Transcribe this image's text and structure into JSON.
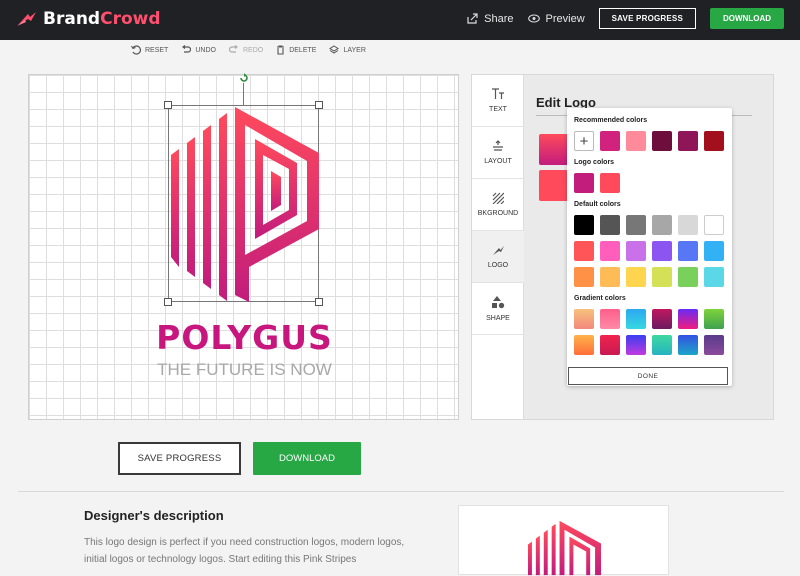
{
  "brand": {
    "name_part1": "Brand",
    "name_part2": "Crowd"
  },
  "topbar": {
    "share_label": "Share",
    "preview_label": "Preview",
    "save_label": "SAVE PROGRESS",
    "download_label": "DOWNLOAD"
  },
  "toolbar": {
    "reset": "RESET",
    "undo": "UNDO",
    "redo": "REDO",
    "delete": "DELETE",
    "layer": "LAYER"
  },
  "logo": {
    "name": "POLYGUS",
    "tagline": "THE FUTURE IS NOW"
  },
  "panel": {
    "title": "Edit Logo",
    "tabs": [
      {
        "label": "TEXT",
        "icon": "text-icon"
      },
      {
        "label": "LAYOUT",
        "icon": "layout-icon"
      },
      {
        "label": "BKGROUND",
        "icon": "background-icon"
      },
      {
        "label": "LOGO",
        "icon": "logo-icon"
      },
      {
        "label": "SHAPE",
        "icon": "shape-icon"
      }
    ]
  },
  "color_picker": {
    "recommended_label": "Recommended colors",
    "recommended": [
      "#d1227d",
      "#ff8a99",
      "#6e0e3d",
      "#8e1558",
      "#a1101c"
    ],
    "logo_label": "Logo colors",
    "logo": [
      "#c21c7d",
      "#ff4a5c"
    ],
    "default_label": "Default colors",
    "default": [
      [
        "#000000",
        "#555555",
        "#777777",
        "#a7a7a7",
        "#d8d8d8",
        "#ffffff"
      ],
      [
        "#ff5559",
        "#ff5ebd",
        "#c871e8",
        "#8c55f2",
        "#5877f4",
        "#33b1f5"
      ],
      [
        "#ff9146",
        "#ffbb55",
        "#ffd54f",
        "#d4e157",
        "#79d15c",
        "#5ad8e8"
      ]
    ],
    "gradient_label": "Gradient colors",
    "gradients": [
      [
        "#f7c27c,#f3877c",
        "#ff5e8a,#ff8aa8",
        "#2ca8f0,#35d8e2",
        "#c0185d,#6b1a63",
        "#6a2bf5,#f01b7e",
        "#7fd33c,#3ea14e"
      ],
      [
        "#ffb34a,#ff6d3a",
        "#f0234d,#c81a52",
        "#3a3ef0,#c03adf",
        "#3fd8a0,#27b3c2",
        "#3452e0,#1ba5c8",
        "#5a3b8c,#8a4a9a"
      ]
    ],
    "done_label": "DONE"
  },
  "actions": {
    "save_label": "SAVE PROGRESS",
    "download_label": "DOWNLOAD"
  },
  "description": {
    "title": "Designer's description",
    "text": "This logo design is perfect if you need construction logos, modern logos, initial logos or technology logos. Start editing this Pink Stripes"
  },
  "colors": {
    "accent_green": "#28a745",
    "logo_magenta": "#c7177e",
    "logo_red": "#ff4a5c",
    "topbar_bg": "#1f2125"
  }
}
